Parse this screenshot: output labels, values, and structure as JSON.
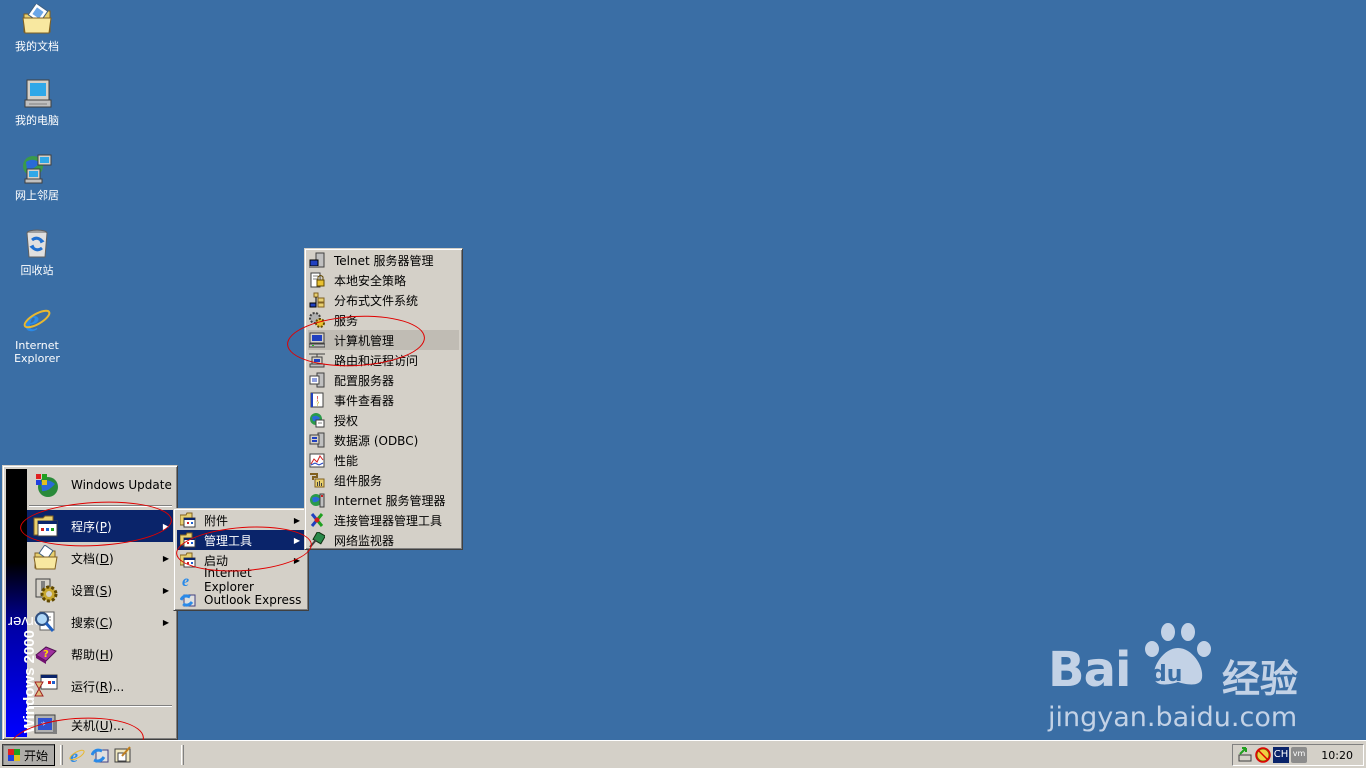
{
  "desktop": {
    "icons": [
      {
        "label": "我的文档",
        "icon": "my-documents-icon"
      },
      {
        "label": "我的电脑",
        "icon": "my-computer-icon"
      },
      {
        "label": "网上邻居",
        "icon": "network-places-icon"
      },
      {
        "label": "回收站",
        "icon": "recycle-bin-icon"
      },
      {
        "label_line1": "Internet",
        "label_line2": "Explorer",
        "icon": "ie-icon"
      }
    ]
  },
  "start_menu": {
    "banner_bold": "Windows 2000",
    "banner_light": " Server",
    "items": [
      {
        "label": "Windows Update",
        "icon": "windows-update-icon"
      },
      {
        "label": "程序(",
        "accel": "P",
        "suffix": ")",
        "icon": "programs-icon",
        "submenu": true,
        "active": true
      },
      {
        "label": "文档(",
        "accel": "D",
        "suffix": ")",
        "icon": "documents-icon",
        "submenu": true
      },
      {
        "label": "设置(",
        "accel": "S",
        "suffix": ")",
        "icon": "settings-icon",
        "submenu": true
      },
      {
        "label": "搜索(",
        "accel": "C",
        "suffix": ")",
        "icon": "search-icon",
        "submenu": true
      },
      {
        "label": "帮助(",
        "accel": "H",
        "suffix": ")",
        "icon": "help-icon"
      },
      {
        "label": "运行(",
        "accel": "R",
        "suffix": ")...",
        "icon": "run-icon"
      },
      {
        "label": "关机(",
        "accel": "U",
        "suffix": ")...",
        "icon": "shutdown-icon"
      }
    ]
  },
  "programs_menu": {
    "items": [
      {
        "label": "附件",
        "submenu": true
      },
      {
        "label": "管理工具",
        "submenu": true,
        "active": true
      },
      {
        "label": "启动",
        "submenu": true
      },
      {
        "label": "Internet Explorer"
      },
      {
        "label": "Outlook Express"
      }
    ]
  },
  "admin_tools_menu": {
    "items": [
      {
        "label": "Telnet 服务器管理"
      },
      {
        "label": "本地安全策略"
      },
      {
        "label": "分布式文件系统"
      },
      {
        "label": "服务"
      },
      {
        "label": "计算机管理",
        "hover": true
      },
      {
        "label": "路由和远程访问"
      },
      {
        "label": "配置服务器"
      },
      {
        "label": "事件查看器"
      },
      {
        "label": "授权"
      },
      {
        "label": "数据源 (ODBC)"
      },
      {
        "label": "性能"
      },
      {
        "label": "组件服务"
      },
      {
        "label": "Internet 服务管理器"
      },
      {
        "label": "连接管理器管理工具"
      },
      {
        "label": "网络监视器"
      }
    ]
  },
  "taskbar": {
    "start_label": "开始",
    "quick_launch": [
      "ie-icon",
      "outlook-express-icon",
      "show-desktop-icon"
    ],
    "tray": {
      "language": "CH",
      "vm_label": "vm",
      "clock": "10:20"
    }
  },
  "watermark": {
    "brand": "Bai",
    "brand_du": "du",
    "product": "经验",
    "url": "jingyan.baidu.com"
  },
  "colors": {
    "desktop": "#3a6ea5",
    "menu_bg": "#d4d0c8",
    "selection": "#0a246a",
    "annotation": "#e00000"
  }
}
